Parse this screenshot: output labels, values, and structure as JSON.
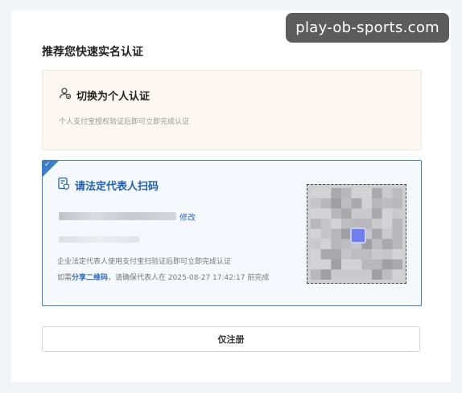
{
  "watermark": "play-ob-sports.com",
  "page_title": "推荐您快速实名认证",
  "personal": {
    "title": "切换为个人认证",
    "description": "个人支付宝授权验证后即可立即完成认证",
    "icon": "user-switch-icon"
  },
  "legal_rep": {
    "title": "请法定代表人扫码",
    "icon": "id-card-shield-icon",
    "edit_label": "修改",
    "description": "企业法定代表人使用支付宝扫验证后即可立即完成认证",
    "share_prefix": "如需",
    "share_link": "分享二维码",
    "share_suffix": "，请确保代表人在 2025-08-27 17:42:17 前完成",
    "selected": true,
    "accent_color": "#3c7ec9"
  },
  "register_button": "仅注册"
}
